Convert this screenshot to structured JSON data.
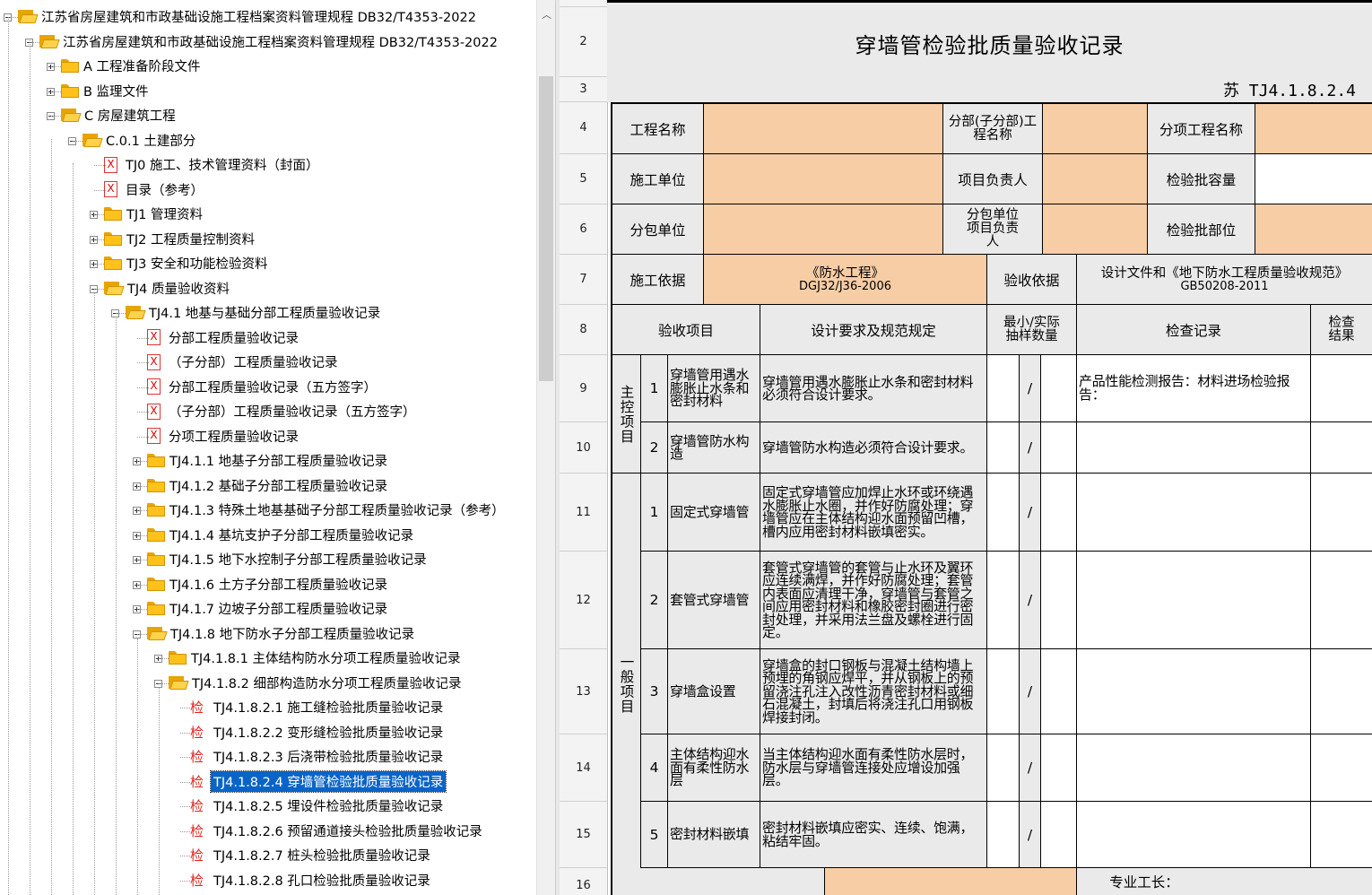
{
  "tree": {
    "nodes": [
      {
        "label": "江苏省房屋建筑和市政基础设施工程档案资料管理规程 DB32/T4353-2022",
        "type": "folder-open",
        "expander": "minus"
      },
      {
        "label": "江苏省房屋建筑和市政基础设施工程档案资料管理规程 DB32/T4353-2022",
        "type": "folder-open",
        "expander": "minus"
      },
      {
        "label": "A 工程准备阶段文件",
        "type": "folder",
        "expander": "plus"
      },
      {
        "label": "B 监理文件",
        "type": "folder",
        "expander": "plus"
      },
      {
        "label": "C 房屋建筑工程",
        "type": "folder-open",
        "expander": "minus"
      },
      {
        "label": "C.0.1 土建部分",
        "type": "folder-open",
        "expander": "minus"
      },
      {
        "label": "TJ0 施工、技术管理资料（封面）",
        "type": "xdoc",
        "expander": ""
      },
      {
        "label": "目录（参考）",
        "type": "xdoc",
        "expander": ""
      },
      {
        "label": "TJ1 管理资料",
        "type": "folder",
        "expander": "plus"
      },
      {
        "label": "TJ2 工程质量控制资料",
        "type": "folder",
        "expander": "plus"
      },
      {
        "label": "TJ3 安全和功能检验资料",
        "type": "folder",
        "expander": "plus"
      },
      {
        "label": "TJ4 质量验收资料",
        "type": "folder-open",
        "expander": "minus"
      },
      {
        "label": "TJ4.1 地基与基础分部工程质量验收记录",
        "type": "folder-open",
        "expander": "minus"
      },
      {
        "label": "分部工程质量验收记录",
        "type": "xdoc",
        "expander": ""
      },
      {
        "label": "（子分部）工程质量验收记录",
        "type": "xdoc",
        "expander": ""
      },
      {
        "label": "分部工程质量验收记录（五方签字）",
        "type": "xdoc",
        "expander": ""
      },
      {
        "label": "（子分部）工程质量验收记录（五方签字）",
        "type": "xdoc",
        "expander": ""
      },
      {
        "label": "分项工程质量验收记录",
        "type": "xdoc",
        "expander": ""
      },
      {
        "label": "TJ4.1.1 地基子分部工程质量验收记录",
        "type": "folder",
        "expander": "plus"
      },
      {
        "label": "TJ4.1.2 基础子分部工程质量验收记录",
        "type": "folder",
        "expander": "plus"
      },
      {
        "label": "TJ4.1.3 特殊土地基基础子分部工程质量验收记录（参考）",
        "type": "folder",
        "expander": "plus"
      },
      {
        "label": "TJ4.1.4 基坑支护子分部工程质量验收记录",
        "type": "folder",
        "expander": "plus"
      },
      {
        "label": "TJ4.1.5 地下水控制子分部工程质量验收记录",
        "type": "folder",
        "expander": "plus"
      },
      {
        "label": "TJ4.1.6 土方子分部工程质量验收记录",
        "type": "folder",
        "expander": "plus"
      },
      {
        "label": "TJ4.1.7 边坡子分部工程质量验收记录",
        "type": "folder",
        "expander": "plus"
      },
      {
        "label": "TJ4.1.8 地下防水子分部工程质量验收记录",
        "type": "folder-open",
        "expander": "minus"
      },
      {
        "label": "TJ4.1.8.1 主体结构防水分项工程质量验收记录",
        "type": "folder",
        "expander": "plus"
      },
      {
        "label": "TJ4.1.8.2 细部构造防水分项工程质量验收记录",
        "type": "folder-open",
        "expander": "minus"
      },
      {
        "label": "TJ4.1.8.2.1 施工缝检验批质量验收记录",
        "type": "check",
        "expander": ""
      },
      {
        "label": "TJ4.1.8.2.2 变形缝检验批质量验收记录",
        "type": "check",
        "expander": ""
      },
      {
        "label": "TJ4.1.8.2.3 后浇带检验批质量验收记录",
        "type": "check",
        "expander": ""
      },
      {
        "label": "TJ4.1.8.2.4 穿墙管检验批质量验收记录",
        "type": "check",
        "expander": "",
        "selected": true
      },
      {
        "label": "TJ4.1.8.2.5 埋设件检验批质量验收记录",
        "type": "check",
        "expander": ""
      },
      {
        "label": "TJ4.1.8.2.6 预留通道接头检验批质量验收记录",
        "type": "check",
        "expander": ""
      },
      {
        "label": "TJ4.1.8.2.7 桩头检验批质量验收记录",
        "type": "check",
        "expander": ""
      },
      {
        "label": "TJ4.1.8.2.8 孔口检验批质量验收记录",
        "type": "check",
        "expander": ""
      }
    ],
    "check_glyph": "检",
    "x_glyph": "X"
  },
  "sheet": {
    "row_numbers": [
      "2",
      "3",
      "4",
      "5",
      "6",
      "7",
      "8",
      "9",
      "10",
      "11",
      "12",
      "13",
      "14",
      "15",
      "16"
    ],
    "title": "穿墙管检验批质量验收记录",
    "code": "苏 TJ4.1.8.2.4",
    "labels": {
      "project_name": "工程名称",
      "sub_division": "分部(子分部)工程名称",
      "sub_item_name": "分项工程名称",
      "construction_unit": "施工单位",
      "project_leader": "项目负责人",
      "batch_capacity": "检验批容量",
      "subcontract_unit": "分包单位",
      "subcontract_leader": "分包单位项目负责人",
      "batch_location": "检验批部位",
      "construction_basis": "施工依据",
      "construction_basis_value": "《防水工程》",
      "construction_basis_code": "DGJ32/J36-2006",
      "acceptance_basis": "验收依据",
      "acceptance_basis_value": "设计文件和《地下防水工程质量验收规范》",
      "acceptance_basis_code": "GB50208-2011"
    },
    "header": {
      "item": "验收项目",
      "requirement": "设计要求及规范规定",
      "sample": "最小/实际抽样数量",
      "record": "检查记录",
      "result": "检查结果"
    },
    "groups": {
      "main": "主控项目",
      "general": "一般项目"
    },
    "rows": [
      {
        "no": "1",
        "item": "穿墙管用遇水膨胀止水条和密封材料",
        "requirement": "穿墙管用遇水膨胀止水条和密封材料必须符合设计要求。",
        "slash": "/",
        "record": "产品性能检测报告：材料进场检验报告："
      },
      {
        "no": "2",
        "item": "穿墙管防水构造",
        "requirement": "穿墙管防水构造必须符合设计要求。",
        "slash": "/",
        "record": ""
      },
      {
        "no": "1",
        "item": "固定式穿墙管",
        "requirement": "固定式穿墙管应加焊止水环或环绕遇水膨胀止水圈，并作好防腐处理；穿墙管应在主体结构迎水面预留凹槽，槽内应用密封材料嵌填密实。",
        "slash": "/",
        "record": ""
      },
      {
        "no": "2",
        "item": "套管式穿墙管",
        "requirement": "套管式穿墙管的套管与止水环及翼环应连续满焊，并作好防腐处理；套管内表面应清理干净，穿墙管与套管之间应用密封材料和橡胶密封圈进行密封处理，并采用法兰盘及螺栓进行固定。",
        "slash": "/",
        "record": ""
      },
      {
        "no": "3",
        "item": "穿墙盒设置",
        "requirement": "穿墙盒的封口钢板与混凝土结构墙上预埋的角钢应焊平，并从钢板上的预留浇注孔注入改性沥青密封材料或细石混凝土，封填后将浇注孔口用钢板焊接封闭。",
        "slash": "/",
        "record": ""
      },
      {
        "no": "4",
        "item": "主体结构迎水面有柔性防水层",
        "requirement": "当主体结构迎水面有柔性防水层时，防水层与穿墙管连接处应增设加强层。",
        "slash": "/",
        "record": ""
      },
      {
        "no": "5",
        "item": "密封材料嵌填",
        "requirement": "密封材料嵌填应密实、连续、饱满，粘结牢固。",
        "slash": "/",
        "record": ""
      }
    ],
    "foreman": "专业工长："
  },
  "colors": {
    "orange_fill": "#f7cda6",
    "gray_fill": "#eaeaea",
    "selection": "#0a64c8"
  }
}
